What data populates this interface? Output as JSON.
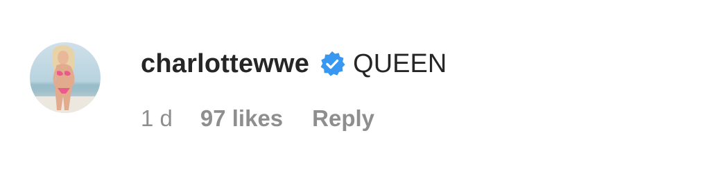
{
  "comment": {
    "avatar_icon": "profile-photo-avatar",
    "username": "charlottewwe",
    "verified_icon": "verified-badge-icon",
    "verified_color": "#3897f0",
    "text": "QUEEN",
    "timestamp": "1 d",
    "likes": "97 likes",
    "reply_label": "Reply"
  }
}
